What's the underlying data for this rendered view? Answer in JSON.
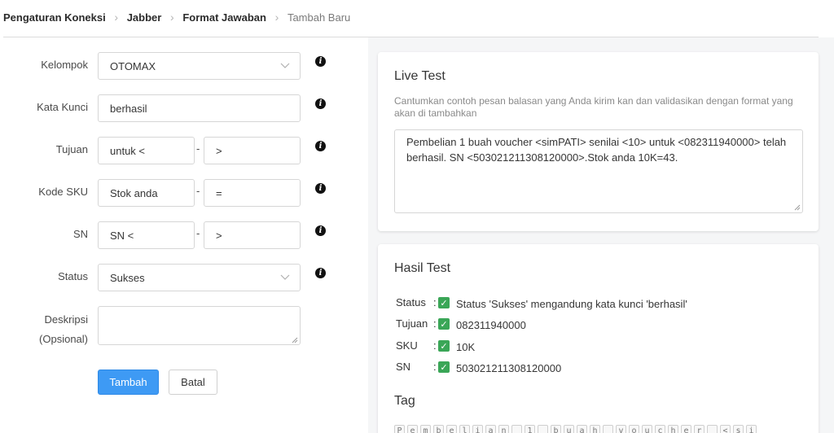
{
  "breadcrumb": [
    "Pengaturan Koneksi",
    "Jabber",
    "Format Jawaban",
    "Tambah Baru"
  ],
  "form": {
    "kelompok": {
      "label": "Kelompok",
      "value": "OTOMAX"
    },
    "kata_kunci": {
      "label": "Kata Kunci",
      "value": "berhasil"
    },
    "tujuan": {
      "label": "Tujuan",
      "value_start": "untuk <",
      "value_end": ">"
    },
    "kode_sku": {
      "label": "Kode SKU",
      "value_start": "Stok anda",
      "value_end": "="
    },
    "sn": {
      "label": "SN",
      "value_start": "SN <",
      "value_end": ">"
    },
    "status": {
      "label": "Status",
      "value": "Sukses"
    },
    "deskripsi": {
      "label": "Deskripsi",
      "label2": "(Opsional)",
      "value": ""
    },
    "separator": "-",
    "info_glyph": "i",
    "submit_label": "Tambah",
    "cancel_label": "Batal"
  },
  "live_test": {
    "title": "Live Test",
    "hint": "Cantumkan contoh pesan balasan yang Anda kirim kan dan validasikan dengan format yang akan di tambahkan",
    "message": "Pembelian 1 buah voucher <simPATI> senilai <10> untuk <082311940000> telah berhasil. SN <503021211308120000>.Stok anda 10K=43."
  },
  "hasil_test": {
    "title": "Hasil Test",
    "colon": ":",
    "check_glyph": "✓",
    "results": [
      {
        "key": "Status",
        "value": "Status 'Sukses' mengandung kata kunci 'berhasil'"
      },
      {
        "key": "Tujuan",
        "value": "082311940000"
      },
      {
        "key": "SKU",
        "value": "10K"
      },
      {
        "key": "SN",
        "value": "503021211308120000"
      }
    ],
    "tag_title": "Tag",
    "tags": [
      "P",
      "e",
      "m",
      "b",
      "e",
      "l",
      "i",
      "a",
      "n",
      " ",
      "1",
      " ",
      "b",
      "u",
      "a",
      "h",
      " ",
      "v",
      "o",
      "u",
      "c",
      "h",
      "e",
      "r",
      " ",
      "<",
      "s",
      "i"
    ]
  },
  "colors": {
    "primary": "#3e9af4",
    "check": "#3aa657",
    "text": "#363636",
    "muted": "#8a8a8a"
  }
}
